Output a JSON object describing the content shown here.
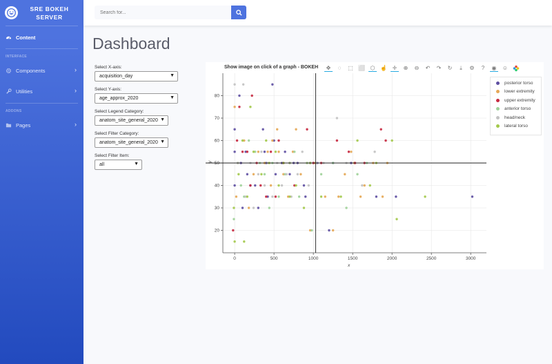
{
  "sidebar": {
    "brand_line1": "SRE BOKEH",
    "brand_line2": "SERVER",
    "content_label": "Content",
    "heading_interface": "INTERFACE",
    "components_label": "Components",
    "utilities_label": "Utilities",
    "heading_addons": "ADDONS",
    "pages_label": "Pages"
  },
  "topbar": {
    "search_placeholder": "Search for..."
  },
  "page": {
    "title": "Dashboard"
  },
  "controls": {
    "x_label": "Select X-axis:",
    "x_value": "acquisition_day",
    "y_label": "Select Y-axis:",
    "y_value": "age_approx_2020",
    "legend_label": "Select Legend Category:",
    "legend_value": "anatom_site_general_2020",
    "filter_label": "Select Filter Category:",
    "filter_value": "anatom_site_general_2020",
    "item_label": "Select Filter Item:",
    "item_value": "all"
  },
  "plot": {
    "title": "Show image on click of a graph - BOKEH"
  },
  "chart_data": {
    "type": "scatter",
    "title": "Show image on click of a graph - BOKEH",
    "xlabel": "x",
    "ylabel": "y",
    "xlim": [
      -150,
      3200
    ],
    "ylim": [
      10,
      90
    ],
    "xticks": [
      0,
      500,
      1000,
      1500,
      2000,
      2500,
      3000
    ],
    "yticks": [
      20,
      30,
      40,
      50,
      60,
      70,
      80
    ],
    "grid": true,
    "legend_position": "top-right",
    "crosshair": {
      "x": 1030,
      "y": 50
    },
    "series": [
      {
        "name": "posterior torso",
        "color": "#5e4fa2",
        "points": [
          [
            0,
            40
          ],
          [
            0,
            55
          ],
          [
            0,
            65
          ],
          [
            60,
            80
          ],
          [
            80,
            50
          ],
          [
            100,
            30
          ],
          [
            140,
            55
          ],
          [
            160,
            45
          ],
          [
            200,
            40
          ],
          [
            260,
            40
          ],
          [
            300,
            30
          ],
          [
            360,
            65
          ],
          [
            380,
            55
          ],
          [
            400,
            50
          ],
          [
            420,
            35
          ],
          [
            480,
            85
          ],
          [
            500,
            60
          ],
          [
            520,
            45
          ],
          [
            600,
            50
          ],
          [
            640,
            55
          ],
          [
            700,
            45
          ],
          [
            750,
            50
          ],
          [
            800,
            50
          ],
          [
            880,
            40
          ],
          [
            900,
            35
          ],
          [
            960,
            50
          ],
          [
            1050,
            50
          ],
          [
            1200,
            20
          ],
          [
            1250,
            50
          ],
          [
            1480,
            50
          ],
          [
            1800,
            35
          ],
          [
            2050,
            35
          ],
          [
            3020,
            35
          ]
        ]
      },
      {
        "name": "lower extremity",
        "color": "#e6a857",
        "points": [
          [
            0,
            75
          ],
          [
            20,
            35
          ],
          [
            40,
            50
          ],
          [
            120,
            60
          ],
          [
            180,
            30
          ],
          [
            240,
            45
          ],
          [
            300,
            55
          ],
          [
            380,
            50
          ],
          [
            420,
            55
          ],
          [
            460,
            40
          ],
          [
            480,
            60
          ],
          [
            540,
            65
          ],
          [
            560,
            55
          ],
          [
            620,
            45
          ],
          [
            680,
            35
          ],
          [
            740,
            55
          ],
          [
            780,
            65
          ],
          [
            840,
            45
          ],
          [
            920,
            50
          ],
          [
            960,
            20
          ],
          [
            1020,
            50
          ],
          [
            1150,
            35
          ],
          [
            1250,
            20
          ],
          [
            1320,
            35
          ],
          [
            1400,
            45
          ],
          [
            1480,
            55
          ],
          [
            1520,
            50
          ],
          [
            1600,
            35
          ],
          [
            1650,
            40
          ],
          [
            1760,
            50
          ],
          [
            1880,
            35
          ],
          [
            1940,
            50
          ]
        ]
      },
      {
        "name": "upper extremity",
        "color": "#c7283f",
        "points": [
          [
            -20,
            20
          ],
          [
            30,
            60
          ],
          [
            60,
            75
          ],
          [
            100,
            55
          ],
          [
            160,
            55
          ],
          [
            200,
            40
          ],
          [
            220,
            80
          ],
          [
            280,
            50
          ],
          [
            330,
            40
          ],
          [
            400,
            35
          ],
          [
            460,
            55
          ],
          [
            520,
            35
          ],
          [
            560,
            60
          ],
          [
            620,
            50
          ],
          [
            700,
            50
          ],
          [
            760,
            40
          ],
          [
            920,
            65
          ],
          [
            1000,
            50
          ],
          [
            1100,
            50
          ],
          [
            1300,
            60
          ],
          [
            1450,
            55
          ],
          [
            1530,
            50
          ],
          [
            1650,
            50
          ],
          [
            1860,
            65
          ],
          [
            1920,
            60
          ]
        ]
      },
      {
        "name": "anterior torso",
        "color": "#9ed199",
        "points": [
          [
            -10,
            25
          ],
          [
            40,
            50
          ],
          [
            80,
            40
          ],
          [
            120,
            35
          ],
          [
            180,
            60
          ],
          [
            260,
            55
          ],
          [
            320,
            50
          ],
          [
            380,
            45
          ],
          [
            440,
            30
          ],
          [
            480,
            50
          ],
          [
            560,
            35
          ],
          [
            640,
            45
          ],
          [
            700,
            50
          ],
          [
            760,
            55
          ],
          [
            820,
            35
          ],
          [
            920,
            50
          ],
          [
            980,
            20
          ],
          [
            1100,
            45
          ],
          [
            1250,
            50
          ],
          [
            1420,
            30
          ],
          [
            1560,
            45
          ],
          [
            1680,
            50
          ]
        ]
      },
      {
        "name": "head/neck",
        "color": "#c2c2c2",
        "points": [
          [
            0,
            85
          ],
          [
            40,
            50
          ],
          [
            110,
            85
          ],
          [
            140,
            35
          ],
          [
            200,
            50
          ],
          [
            240,
            30
          ],
          [
            300,
            45
          ],
          [
            340,
            55
          ],
          [
            380,
            40
          ],
          [
            420,
            50
          ],
          [
            480,
            35
          ],
          [
            540,
            50
          ],
          [
            600,
            40
          ],
          [
            660,
            45
          ],
          [
            720,
            35
          ],
          [
            800,
            45
          ],
          [
            860,
            55
          ],
          [
            940,
            40
          ],
          [
            1040,
            50
          ],
          [
            1130,
            50
          ],
          [
            1300,
            70
          ],
          [
            1420,
            50
          ],
          [
            1620,
            40
          ],
          [
            1780,
            55
          ]
        ]
      },
      {
        "name": "lateral torso",
        "color": "#a3c94b",
        "points": [
          [
            0,
            15
          ],
          [
            -10,
            30
          ],
          [
            50,
            45
          ],
          [
            100,
            60
          ],
          [
            120,
            15
          ],
          [
            160,
            35
          ],
          [
            200,
            75
          ],
          [
            240,
            55
          ],
          [
            340,
            45
          ],
          [
            400,
            60
          ],
          [
            440,
            50
          ],
          [
            520,
            55
          ],
          [
            560,
            40
          ],
          [
            620,
            50
          ],
          [
            700,
            35
          ],
          [
            780,
            40
          ],
          [
            880,
            30
          ],
          [
            960,
            50
          ],
          [
            1100,
            35
          ],
          [
            1350,
            35
          ],
          [
            1560,
            60
          ],
          [
            1720,
            40
          ],
          [
            1800,
            50
          ],
          [
            2000,
            60
          ],
          [
            2060,
            25
          ],
          [
            2420,
            35
          ]
        ]
      }
    ]
  }
}
